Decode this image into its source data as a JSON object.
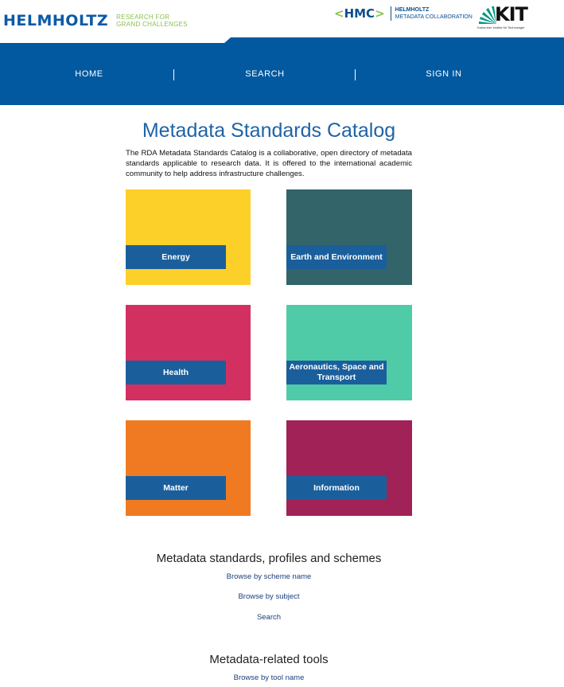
{
  "header": {
    "helmholtz_logo_text": "HELMHOLTZ",
    "helmholtz_tagline_1": "RESEARCH FOR",
    "helmholtz_tagline_2": "GRAND CHALLENGES",
    "hmc_logo_text": "HMC",
    "hmc_sub_1": "HELMHOLTZ",
    "hmc_sub_2": "METADATA COLLABORATION",
    "kit_logo_text": "KIT",
    "kit_sub": "Karlsruher Institut für Technologie"
  },
  "nav": {
    "items": [
      {
        "label": "HOME"
      },
      {
        "label": "SEARCH"
      },
      {
        "label": "SIGN IN"
      }
    ],
    "background": "#02599f"
  },
  "main": {
    "title": "Metadata Standards Catalog",
    "intro": "The RDA Metadata Standards Catalog is a collaborative, open directory of metadata standards applicable to research data. It is offered to the international academic community to help address infrastructure challenges.",
    "tiles": [
      {
        "label": "Energy",
        "color": "#fdd029"
      },
      {
        "label": "Earth and Environment",
        "color": "#326469"
      },
      {
        "label": "Health",
        "color": "#d33062"
      },
      {
        "label": "Aeronautics, Space and Transport",
        "color": "#50cba8"
      },
      {
        "label": "Matter",
        "color": "#f07a22"
      },
      {
        "label": "Information",
        "color": "#a12256"
      }
    ]
  },
  "standards_section": {
    "heading": "Metadata standards, profiles and schemes",
    "links": [
      "Browse by scheme name",
      "Browse by subject",
      "Search"
    ]
  },
  "tools_section": {
    "heading": "Metadata-related tools",
    "links": [
      "Browse by tool name"
    ]
  }
}
